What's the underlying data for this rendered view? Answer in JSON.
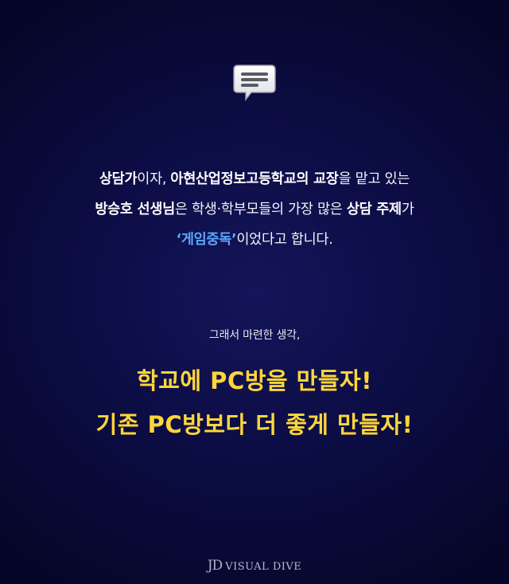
{
  "icon": "chat-bubble-icon",
  "intro": {
    "line1": {
      "p1": "상담가",
      "p2": "이자, ",
      "p3": "아현산업정보고등학교의 교장",
      "p4": "을 맡고 있는"
    },
    "line2": {
      "p1": "방승호 선생님",
      "p2": "은 학생·학부모들의 가장 많은 ",
      "p3": "상담 주제",
      "p4": "가"
    },
    "line3": {
      "p1": "‘게임중독’",
      "p2": "이었다고 합니다."
    }
  },
  "lead": "그래서 마련한 생각,",
  "headline": {
    "line1": "학교에 PC방을 만들자!",
    "line2": "기존 PC방보다 더 좋게 만들자!"
  },
  "logo": {
    "mark": "JD",
    "text": "VISUAL DIVE"
  },
  "colors": {
    "accent_yellow": "#ffd63a",
    "highlight_blue": "#5aa8ff",
    "background": "#0c0d45"
  }
}
